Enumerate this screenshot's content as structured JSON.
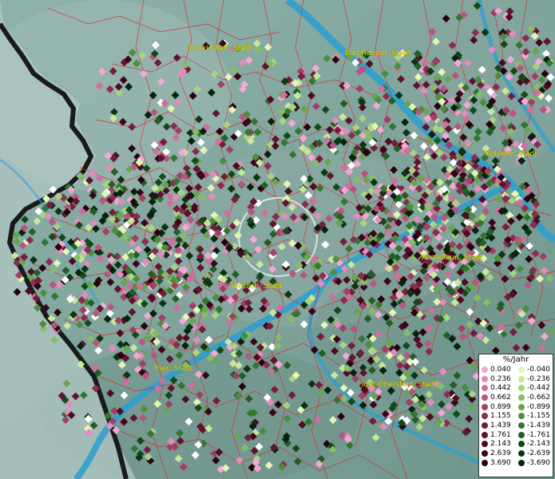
{
  "cities": [
    {
      "name": "Euskirchen, Stadt"
    },
    {
      "name": "Bad Honnef, Stadt"
    },
    {
      "name": "Koblenz, Stadt"
    },
    {
      "name": "Kastellaun, Stadt"
    },
    {
      "name": "Wittlich, Stadt"
    },
    {
      "name": "Trier, Stadt"
    },
    {
      "name": "Idar-Oberstein, Stadt"
    }
  ],
  "legend": {
    "title": "%/Jahr",
    "positive": [
      {
        "label": "0.040",
        "color": "#f5a6d8"
      },
      {
        "label": "0.236",
        "color": "#e58bbd"
      },
      {
        "label": "0.442",
        "color": "#cf6f9e"
      },
      {
        "label": "0.662",
        "color": "#b85680"
      },
      {
        "label": "0.899",
        "color": "#a13f66"
      },
      {
        "label": "1.155",
        "color": "#8a2c4f"
      },
      {
        "label": "1.439",
        "color": "#751d3d"
      },
      {
        "label": "1.761",
        "color": "#61132f"
      },
      {
        "label": "2.143",
        "color": "#4e0b22"
      },
      {
        "label": "2.639",
        "color": "#3b0617"
      },
      {
        "label": "3.690",
        "color": "#2a020d"
      }
    ],
    "negative": [
      {
        "label": "-0.040",
        "color": "#e4f5b4"
      },
      {
        "label": "-0.236",
        "color": "#c9e79a"
      },
      {
        "label": "-0.442",
        "color": "#a8d37f"
      },
      {
        "label": "-0.662",
        "color": "#86bd66"
      },
      {
        "label": "-0.899",
        "color": "#66a64f"
      },
      {
        "label": "-1.155",
        "color": "#4b8e3d"
      },
      {
        "label": "-1.439",
        "color": "#34762f"
      },
      {
        "label": "-1.761",
        "color": "#225f24"
      },
      {
        "label": "-2.143",
        "color": "#144a1a"
      },
      {
        "label": "-2.639",
        "color": "#0b3612"
      },
      {
        "label": "-3.690",
        "color": "#04240b"
      }
    ],
    "white_marker_color": "#ffffff"
  },
  "colors": {
    "terrain": "#7fa39c",
    "rivers": "#2a9fd0",
    "boundaries": "#e0202a",
    "border": "#1a1a1a",
    "label": "#f2e300"
  }
}
